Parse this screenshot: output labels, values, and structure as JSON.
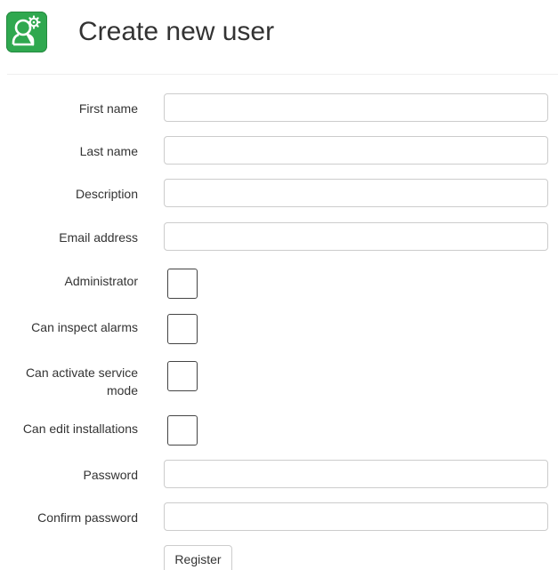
{
  "header": {
    "title": "Create new user",
    "logo_icon": "user-gear-icon",
    "logo_color": "#2fa84f"
  },
  "form": {
    "first_name": {
      "label": "First name",
      "value": ""
    },
    "last_name": {
      "label": "Last name",
      "value": ""
    },
    "description": {
      "label": "Description",
      "value": ""
    },
    "email": {
      "label": "Email address",
      "value": ""
    },
    "administrator": {
      "label": "Administrator",
      "checked": false
    },
    "can_inspect_alarms": {
      "label": "Can inspect alarms",
      "checked": false
    },
    "can_activate_service_mode": {
      "label": "Can activate service mode",
      "checked": false
    },
    "can_edit_installations": {
      "label": "Can edit installations",
      "checked": false
    },
    "password": {
      "label": "Password",
      "value": ""
    },
    "confirm_password": {
      "label": "Confirm password",
      "value": ""
    },
    "register_label": "Register"
  }
}
